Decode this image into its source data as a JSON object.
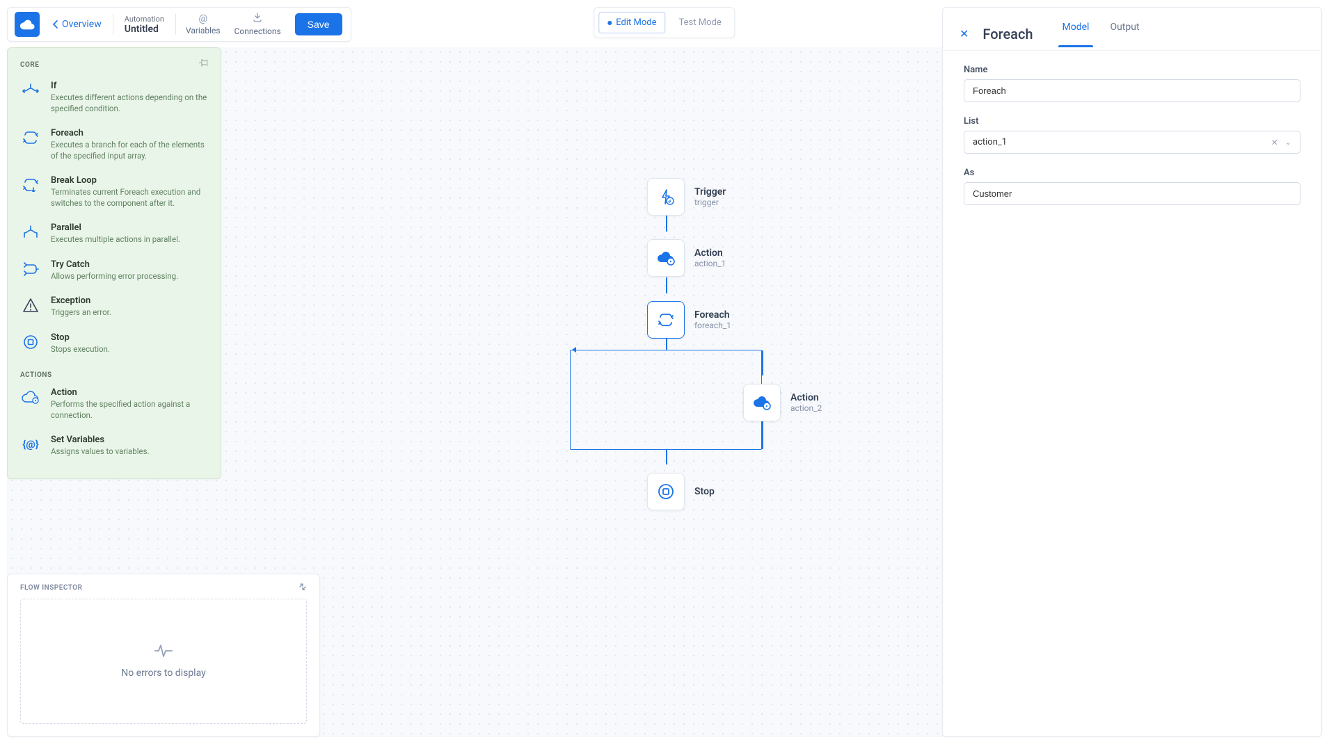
{
  "toolbar": {
    "overview": "Overview",
    "subtitle_label": "Automation",
    "subtitle_value": "Untitled",
    "variables": "Variables",
    "connections": "Connections",
    "save": "Save"
  },
  "modes": {
    "edit": "Edit Mode",
    "test": "Test Mode"
  },
  "palette": {
    "core_title": "CORE",
    "actions_title": "ACTIONS",
    "core": [
      {
        "name": "If",
        "desc": "Executes different actions depending on the specified condition."
      },
      {
        "name": "Foreach",
        "desc": "Executes a branch for each of the elements of the specified input array."
      },
      {
        "name": "Break Loop",
        "desc": "Terminates current Foreach execution and switches to the component after it."
      },
      {
        "name": "Parallel",
        "desc": "Executes multiple actions in parallel."
      },
      {
        "name": "Try Catch",
        "desc": "Allows performing error processing."
      },
      {
        "name": "Exception",
        "desc": "Triggers an error."
      },
      {
        "name": "Stop",
        "desc": "Stops execution."
      }
    ],
    "actions": [
      {
        "name": "Action",
        "desc": "Performs the specified action against a connection."
      },
      {
        "name": "Set Variables",
        "desc": "Assigns values to variables."
      }
    ]
  },
  "inspector": {
    "title": "FLOW INSPECTOR",
    "empty": "No errors to display"
  },
  "rpanel": {
    "title": "Foreach",
    "tab_model": "Model",
    "tab_output": "Output",
    "name_label": "Name",
    "name_value": "Foreach",
    "list_label": "List",
    "list_value": "action_1",
    "as_label": "As",
    "as_value": "Customer"
  },
  "flow": {
    "trigger_name": "Trigger",
    "trigger_id": "trigger",
    "action1_name": "Action",
    "action1_id": "action_1",
    "foreach_name": "Foreach",
    "foreach_id": "foreach_1",
    "action2_name": "Action",
    "action2_id": "action_2",
    "stop_name": "Stop"
  }
}
